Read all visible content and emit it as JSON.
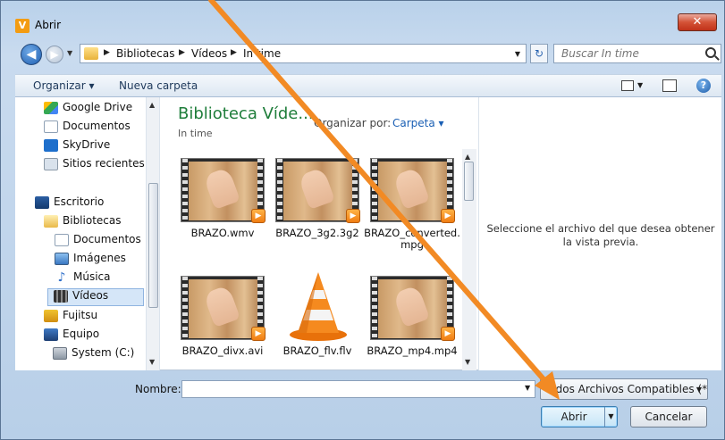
{
  "window": {
    "title": "Abrir",
    "logo_letter": "V",
    "close_glyph": "✕"
  },
  "navigation": {
    "back_glyph": "◀",
    "forward_glyph": "▶",
    "breadcrumb": [
      "Bibliotecas",
      "Vídeos",
      "In time"
    ],
    "separator": "▶",
    "refresh_glyph": "↻",
    "search_placeholder": "Buscar In time"
  },
  "command_bar": {
    "organize": "Organizar ▾",
    "new_folder": "Nueva carpeta",
    "help": "?"
  },
  "sidebar": {
    "items": [
      {
        "label": "Google Drive",
        "icon": "google-drive-icon"
      },
      {
        "label": "Documentos",
        "icon": "document-icon"
      },
      {
        "label": "SkyDrive",
        "icon": "skydrive-icon"
      },
      {
        "label": "Sitios recientes",
        "icon": "recent-places-icon"
      },
      {
        "label": "Escritorio",
        "icon": "desktop-icon"
      },
      {
        "label": "Bibliotecas",
        "icon": "libraries-icon"
      },
      {
        "label": "Documentos",
        "icon": "document-icon"
      },
      {
        "label": "Imágenes",
        "icon": "pictures-icon"
      },
      {
        "label": "Música",
        "icon": "music-icon"
      },
      {
        "label": "Vídeos",
        "icon": "videos-icon"
      },
      {
        "label": "Fujitsu",
        "icon": "user-folder-icon"
      },
      {
        "label": "Equipo",
        "icon": "computer-icon"
      },
      {
        "label": "System (C:)",
        "icon": "hard-drive-icon"
      }
    ],
    "selected": "Vídeos"
  },
  "library": {
    "title": "Biblioteca Víde...",
    "subtitle": "In time",
    "arrange_by_label": "Organizar por:",
    "arrange_by_value": "Carpeta ▾"
  },
  "files": [
    {
      "name": "BRAZO.wmv",
      "kind": "video"
    },
    {
      "name": "BRAZO_3g2.3g2",
      "kind": "video"
    },
    {
      "name": "BRAZO_converted.mpg",
      "kind": "video"
    },
    {
      "name": "BRAZO_divx.avi",
      "kind": "video"
    },
    {
      "name": "BRAZO_flv.flv",
      "kind": "vlc"
    },
    {
      "name": "BRAZO_mp4.mp4",
      "kind": "video"
    }
  ],
  "preview": {
    "message": "Seleccione el archivo del que desea obtener la vista previa."
  },
  "footer": {
    "name_label": "Nombre:",
    "name_value": "",
    "filter": "Todos Archivos Compatibles (*",
    "open_button": "Abrir",
    "cancel_button": "Cancelar"
  },
  "annotation": {
    "arrow_color": "#f28a24"
  }
}
